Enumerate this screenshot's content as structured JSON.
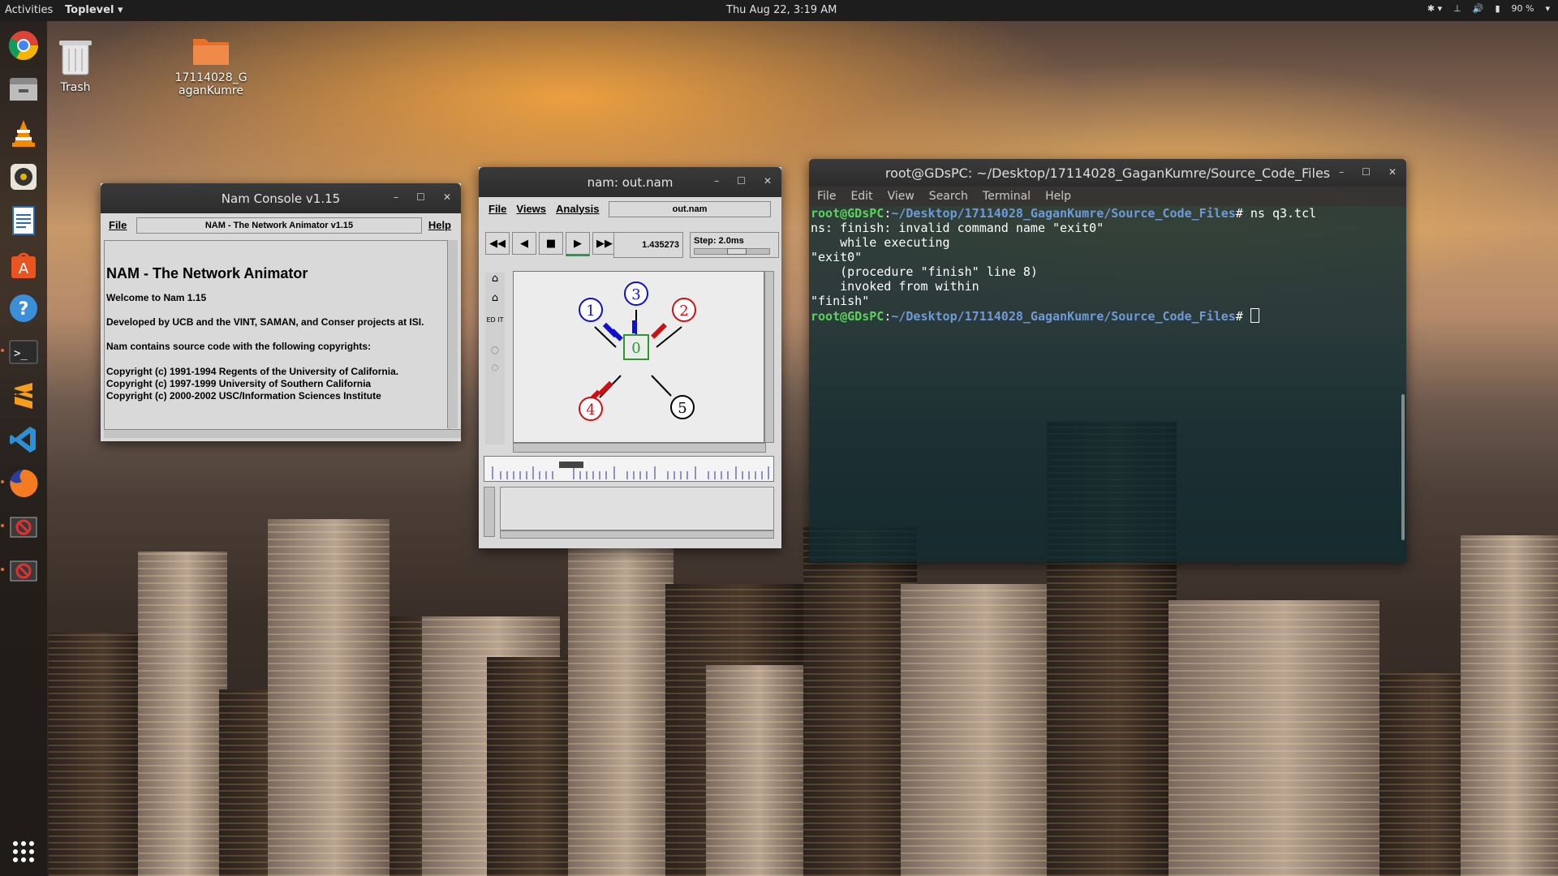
{
  "topbar": {
    "activities": "Activities",
    "app_menu": "Toplevel",
    "clock": "Thu Aug 22,  3:19 AM",
    "battery": "90 %"
  },
  "desktop": {
    "trash_label": "Trash",
    "folder_label": "17114028_GaganKumre"
  },
  "dock": {
    "items": [
      "chrome-icon",
      "files-icon",
      "vlc-icon",
      "rhythmbox-icon",
      "writer-icon",
      "software-icon",
      "help-icon",
      "terminal-icon",
      "sublime-icon",
      "vscode-icon",
      "firefox-icon",
      "blocked-app-icon",
      "blocked-app-icon",
      "app-grid-icon"
    ]
  },
  "nam_console": {
    "title": "Nam Console v1.15",
    "menu_file": "File",
    "menu_help": "Help",
    "header_field": "NAM - The Network Animator v1.15",
    "heading": "NAM - The Network Animator",
    "line_welcome": "Welcome to Nam 1.15",
    "line_dev": "Developed by UCB and the VINT, SAMAN, and Conser projects at ISI.",
    "line_src": "Nam contains source code with the following copyrights:",
    "copyright1": "Copyright (c) 1991-1994 Regents of the University of California.",
    "copyright2": "Copyright (c) 1997-1999 University of Southern California",
    "copyright3": "Copyright (c) 2000-2002 USC/Information Sciences Institute"
  },
  "nam_anim": {
    "title": "nam: out.nam",
    "menu_file": "File",
    "menu_views": "Views",
    "menu_analysis": "Analysis",
    "file_field": "out.nam",
    "time_value": "1.435273",
    "step_label": "Step: 2.0ms",
    "edit_label": "ED IT",
    "nodes": [
      {
        "id": "0",
        "color": "#2a9a2a"
      },
      {
        "id": "1",
        "color": "#1010d0"
      },
      {
        "id": "2",
        "color": "#d01010"
      },
      {
        "id": "3",
        "color": "#1010d0"
      },
      {
        "id": "4",
        "color": "#d01010"
      },
      {
        "id": "5",
        "color": "#000000"
      }
    ]
  },
  "terminal": {
    "title": "root@GDsPC: ~/Desktop/17114028_GaganKumre/Source_Code_Files",
    "menu": [
      "File",
      "Edit",
      "View",
      "Search",
      "Terminal",
      "Help"
    ],
    "prompt_user": "root@GDsPC",
    "prompt_path": "~/Desktop/17114028_GaganKumre/Source_Code_Files",
    "command": "# ns q3.tcl",
    "output": [
      "ns: finish: invalid command name \"exit0\"",
      "    while executing",
      "\"exit0\"",
      "    (procedure \"finish\" line 8)",
      "    invoked from within",
      "\"finish\""
    ],
    "prompt_end": "# "
  }
}
